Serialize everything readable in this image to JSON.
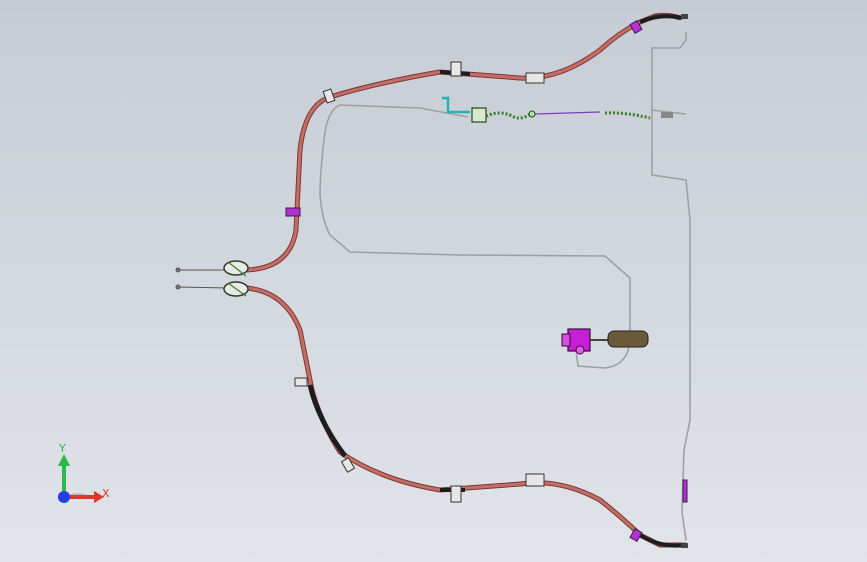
{
  "viewport": {
    "background_top": "#c6ccd5",
    "background_bottom": "#e1e4e9"
  },
  "assembly": {
    "cable_color": "#c46d66",
    "cable_outline": "#7a3a35",
    "black_sleeve_color": "#1d1d1d",
    "clip_color": "#e7e7e7",
    "bracket_color": "#8a2bd6",
    "tube_color": "#9da1a7",
    "green_spring_color": "#3c7a2c",
    "teal_component_color": "#22b4b0",
    "magenta_unit_color": "#c61fd6"
  },
  "triad": {
    "y_label": "Y",
    "x_label": "X",
    "y_color": "#2fb84a",
    "x_color": "#e0362c",
    "z_color": "#2440e0"
  }
}
